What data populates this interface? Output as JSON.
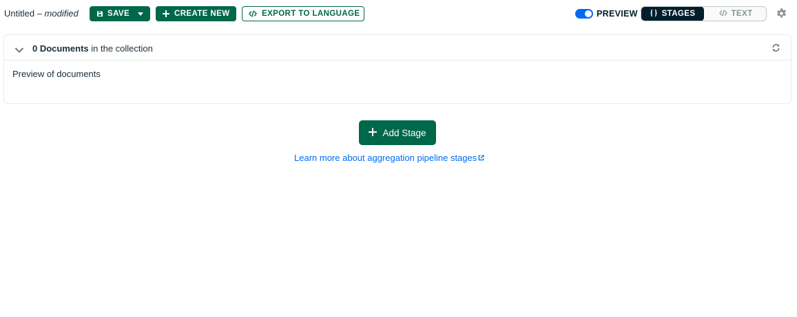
{
  "header": {
    "title": "Untitled",
    "separator": " – ",
    "modified": "modified",
    "save_label": "SAVE",
    "create_new_label": "CREATE NEW",
    "export_label": "EXPORT TO LANGUAGE",
    "preview_label": "PREVIEW",
    "preview_enabled": true,
    "view_modes": [
      {
        "label": "STAGES",
        "icon": "curly-braces-icon",
        "selected": true
      },
      {
        "label": "TEXT",
        "icon": "code-icon",
        "selected": false
      }
    ]
  },
  "preview_panel": {
    "count_bold": "0 Documents",
    "count_rest": " in the collection",
    "body_text": "Preview of documents"
  },
  "actions": {
    "add_stage_label": "Add Stage",
    "learn_more_label": "Learn more about aggregation pipeline stages"
  },
  "colors": {
    "primary_green": "#00684a",
    "link_blue": "#016bf8",
    "dark": "#001e2b"
  }
}
